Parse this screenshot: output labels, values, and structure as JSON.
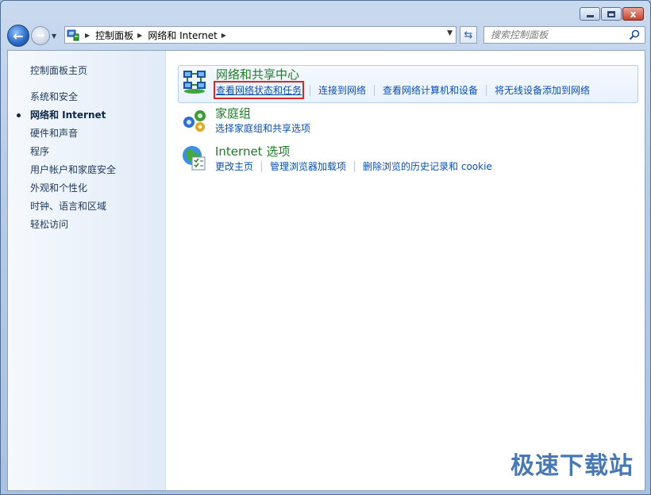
{
  "window": {
    "controls": {
      "minimize_icon": "minimize-icon",
      "maximize_icon": "maximize-icon",
      "close_icon": "close-icon",
      "close_glyph": "x"
    }
  },
  "navigation": {
    "back_icon": "back-arrow-icon",
    "forward_icon": "forward-arrow-icon",
    "breadcrumbs": [
      "控制面板",
      "网络和 Internet"
    ],
    "search_placeholder": "搜索控制面板"
  },
  "sidebar": {
    "items": [
      {
        "label": "控制面板主页",
        "active": false
      },
      {
        "label": "系统和安全",
        "active": false
      },
      {
        "label": "网络和 Internet",
        "active": true
      },
      {
        "label": "硬件和声音",
        "active": false
      },
      {
        "label": "程序",
        "active": false
      },
      {
        "label": "用户帐户和家庭安全",
        "active": false
      },
      {
        "label": "外观和个性化",
        "active": false
      },
      {
        "label": "时钟、语言和区域",
        "active": false
      },
      {
        "label": "轻松访问",
        "active": false
      }
    ]
  },
  "categories": [
    {
      "title": "网络和共享中心",
      "icon": "network-icon",
      "links": [
        "查看网络状态和任务",
        "连接到网络",
        "查看网络计算机和设备",
        "将无线设备添加到网络"
      ]
    },
    {
      "title": "家庭组",
      "icon": "homegroup-icon",
      "links": [
        "选择家庭组和共享选项"
      ]
    },
    {
      "title": "Internet 选项",
      "icon": "internet-options-icon",
      "links": [
        "更改主页",
        "管理浏览器加载项",
        "删除浏览的历史记录和 cookie"
      ]
    }
  ],
  "watermark": "极速下载站",
  "colors": {
    "link": "#0b4fb1",
    "category_title": "#1e7b28",
    "highlight_box": "#d92626"
  }
}
